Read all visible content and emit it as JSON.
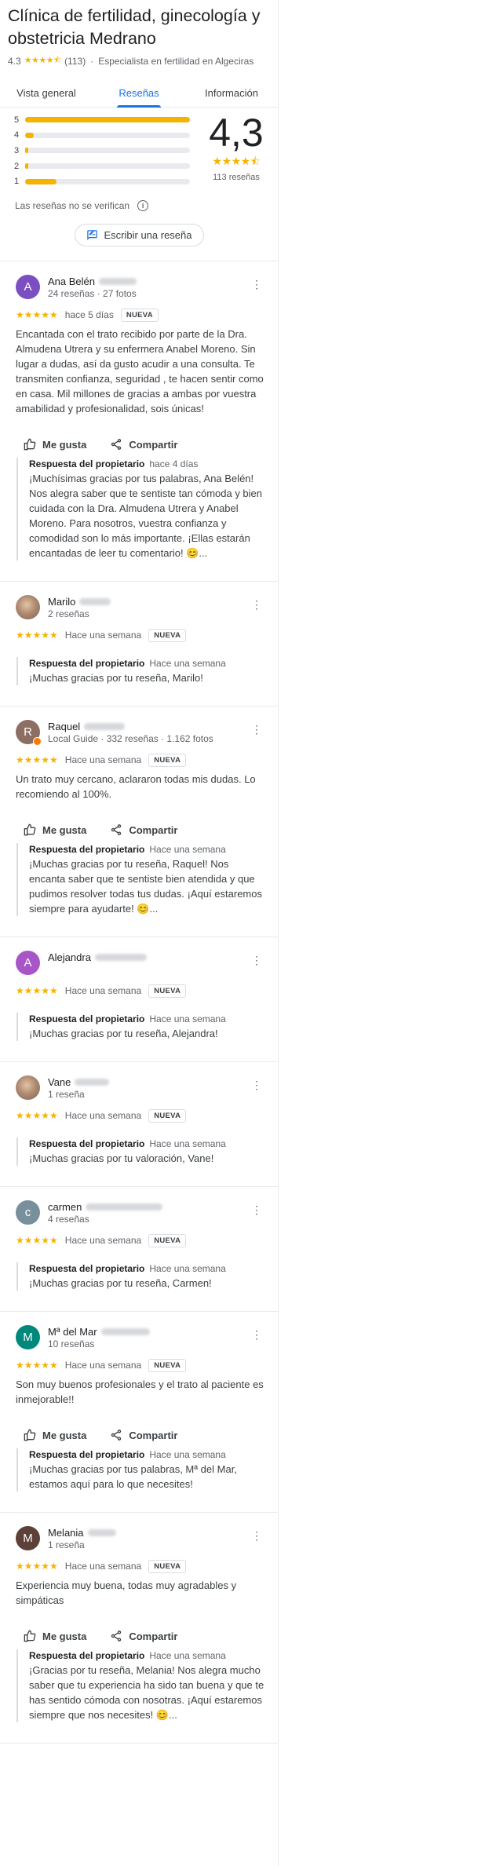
{
  "place": {
    "title": "Clínica de fertilidad, ginecología y obstetricia Medrano",
    "rating": "4,3",
    "rating_small": "4.3",
    "count": "(113)",
    "category": "Especialista en fertilidad en Algeciras"
  },
  "tabs": [
    {
      "label": "Vista general"
    },
    {
      "label": "Reseñas",
      "active": true
    },
    {
      "label": "Información"
    }
  ],
  "histogram": [
    {
      "stars": "5",
      "fraction": 1.0
    },
    {
      "stars": "4",
      "fraction": 0.05
    },
    {
      "stars": "3",
      "fraction": 0.02
    },
    {
      "stars": "2",
      "fraction": 0.02
    },
    {
      "stars": "1",
      "fraction": 0.19
    }
  ],
  "summary": {
    "avg": "4,3",
    "count_label": "113 reseñas",
    "stars": "★★★★⯪"
  },
  "unverified_label": "Las reseñas no se verifican",
  "write_review_label": "Escribir una reseña",
  "labels": {
    "like": "Me gusta",
    "share": "Compartir",
    "owner": "Respuesta del propietario",
    "new": "NUEVA"
  },
  "colors": {
    "accent": "#1a73e8",
    "star": "#f5b301"
  },
  "reviews": [
    {
      "name": "Ana Belén",
      "sub": "24 reseñas · 27 fotos",
      "avatar_letter": "A",
      "avatar_color": "#7b4fc1",
      "when": "hace 5 días",
      "text": "Encantada con el trato recibido por parte de la Dra. Almudena Utrera y su enfermera Anabel Moreno. Sin lugar a dudas, así da gusto acudir a una consulta. Te transmiten confianza, seguridad , te hacen sentir como en casa. Mil millones de gracias a ambas por vuestra amabilidad y profesionalidad, sois únicas!",
      "owner_when": "hace 4 días",
      "owner_text": "¡Muchísimas gracias por tus palabras, Ana Belén! Nos alegra saber que te sentiste tan cómoda y bien cuidada con la Dra. Almudena Utrera y Anabel Moreno. Para nosotros, vuestra confianza y comodidad son lo más importante. ¡Ellas estarán encantadas de leer tu comentario! 😊..."
    },
    {
      "name": "Marilo",
      "sub": "2 reseñas",
      "avatar_letter": "",
      "avatar_color": "",
      "when": "Hace una semana",
      "text": "",
      "owner_when": "Hace una semana",
      "owner_text": "¡Muchas gracias por tu reseña, Marilo!"
    },
    {
      "name": "Raquel",
      "sub": "Local Guide · 332 reseñas · 1.162 fotos",
      "avatar_letter": "R",
      "avatar_color": "#8d6e63",
      "when": "Hace una semana",
      "text": "Un trato muy cercano, aclararon todas mis dudas. Lo recomiendo al 100%.",
      "owner_when": "Hace una semana",
      "owner_text": "¡Muchas gracias por tu reseña, Raquel! Nos encanta saber que te sentiste bien atendida y que pudimos resolver todas tus dudas. ¡Aquí estaremos siempre para ayudarte! 😊..."
    },
    {
      "name": "Alejandra",
      "sub": "",
      "avatar_letter": "A",
      "avatar_color": "#a855c7",
      "when": "Hace una semana",
      "text": "",
      "owner_when": "Hace una semana",
      "owner_text": "¡Muchas gracias por tu reseña, Alejandra!"
    },
    {
      "name": "Vane",
      "sub": "1 reseña",
      "avatar_letter": "",
      "avatar_color": "",
      "when": "Hace una semana",
      "text": "",
      "owner_when": "Hace una semana",
      "owner_text": "¡Muchas gracias por tu valoración, Vane!"
    },
    {
      "name": "carmen",
      "sub": "4 reseñas",
      "avatar_letter": "c",
      "avatar_color": "#78909c",
      "when": "Hace una semana",
      "text": "",
      "owner_when": "Hace una semana",
      "owner_text": "¡Muchas gracias por tu reseña, Carmen!"
    },
    {
      "name": "Mª del Mar",
      "sub": "10 reseñas",
      "avatar_letter": "M",
      "avatar_color": "#00897b",
      "when": "Hace una semana",
      "text": "Son muy buenos profesionales y el trato al paciente es inmejorable!!",
      "owner_when": "Hace una semana",
      "owner_text": "¡Muchas gracias por tus palabras, Mª del Mar, estamos aquí para lo que necesites!"
    },
    {
      "name": "Melania",
      "sub": "1 reseña",
      "avatar_letter": "M",
      "avatar_color": "#5d4037",
      "when": "Hace una semana",
      "text": "Experiencia muy buena, todas muy agradables y simpáticas",
      "owner_when": "Hace una semana",
      "owner_text": "¡Gracias por tu reseña, Melania! Nos alegra mucho saber que tu experiencia ha sido tan buena y que te has sentido cómoda con nosotras. ¡Aquí estaremos siempre que nos necesites! 😊..."
    }
  ]
}
